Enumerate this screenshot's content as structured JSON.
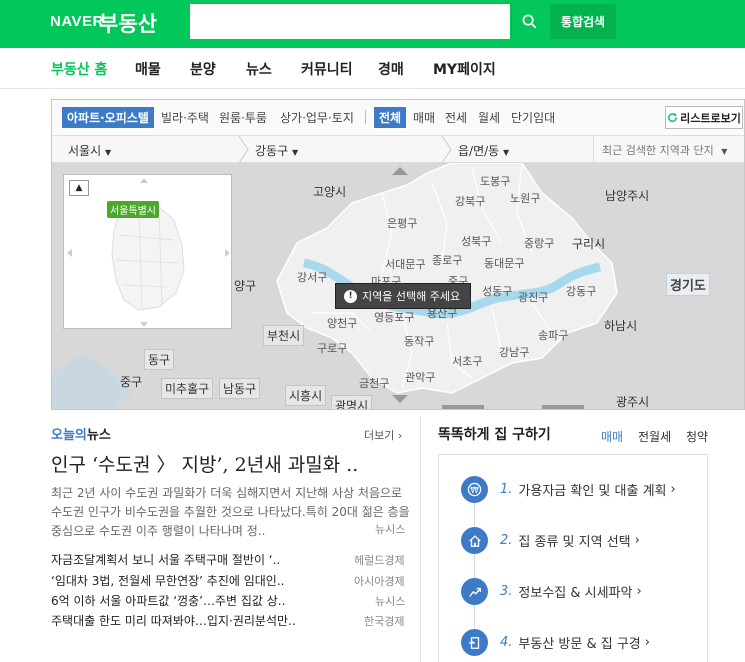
{
  "header": {
    "logo_naver": "NAVER",
    "logo_land": "부동산",
    "search_placeholder": "",
    "search_value": "",
    "total_search": "통합검색"
  },
  "nav": {
    "items": [
      "부동산 홈",
      "매물",
      "분양",
      "뉴스",
      "커뮤니티",
      "경매",
      "MY페이지"
    ]
  },
  "map": {
    "type_tabs": [
      "아파트·오피스텔",
      "빌라·주택",
      "원룸·투룸",
      "상가·업무·토지"
    ],
    "deal_tabs": [
      "전체",
      "매매",
      "전세",
      "월세",
      "단기임대"
    ],
    "list_button": "리스트로보기",
    "selectors": [
      "서울시",
      "강동구",
      "읍/면/동"
    ],
    "recent_placeholder": "최근 검색한 지역과 단지",
    "mini_badge": "서울특별시",
    "tooltip": "지역을 선택해 주세요",
    "districts": [
      "도봉구",
      "노원구",
      "강북구",
      "은평구",
      "성북구",
      "중랑구",
      "서대문구",
      "종로구",
      "동대문구",
      "강서구",
      "마포구",
      "중구",
      "성동구",
      "광진구",
      "강동구",
      "양천구",
      "영등포구",
      "용산구",
      "구로구",
      "동작구",
      "송파구",
      "서초구",
      "강남구",
      "관악구",
      "금천구"
    ],
    "outside_labels": [
      "고양시",
      "남양주시",
      "구리시",
      "경기도",
      "하남시",
      "양구",
      "부천시",
      "동구",
      "중구",
      "미추홀구",
      "남동구",
      "시흥시",
      "광명시",
      "광주시"
    ]
  },
  "news": {
    "head_highlight": "오늘의",
    "head_rest": "뉴스",
    "more": "더보기",
    "title": "인구 ‘수도권 〉 지방’, 2년새 과밀화 ..",
    "summary": "최근 2년 사이 수도권 과밀화가 더욱 심해지면서 지난해 사상 처음으로 수도권 인구가 비수도권을 추월한 것으로 나타났다.특히 20대 젊은 층을 중심으로 수도권 이주 행렬이 나타나며 정..",
    "summary_source": "뉴시스",
    "items": [
      {
        "title": "자금조달계획서 보니 서울 주택구매 절반이 ‘..",
        "source": "헤럴드경제"
      },
      {
        "title": "‘임대차 3법, 전월세 무한연장’ 추진에 임대인..",
        "source": "아시아경제"
      },
      {
        "title": "6억 이하 서울 아파트값 ‘껑충’…주변 집값 상..",
        "source": "뉴시스"
      },
      {
        "title": "주택대출 한도 미리 따져봐야…입지·권리분석만..",
        "source": "한국경제"
      }
    ]
  },
  "smart": {
    "title": "똑똑하게 집 구하기",
    "tabs": [
      "매매",
      "전월세",
      "청약"
    ],
    "steps": [
      {
        "num": "1.",
        "text": "가용자금 확인 및 대출 계획"
      },
      {
        "num": "2.",
        "text": "집 종류 및 지역 선택"
      },
      {
        "num": "3.",
        "text": "정보수집 & 시세파악"
      },
      {
        "num": "4.",
        "text": "부동산 방문 & 집 구경"
      }
    ]
  },
  "colors": {
    "brand": "#03c75a",
    "accent": "#3e7bc7",
    "han_river": "#a8d8ec"
  }
}
